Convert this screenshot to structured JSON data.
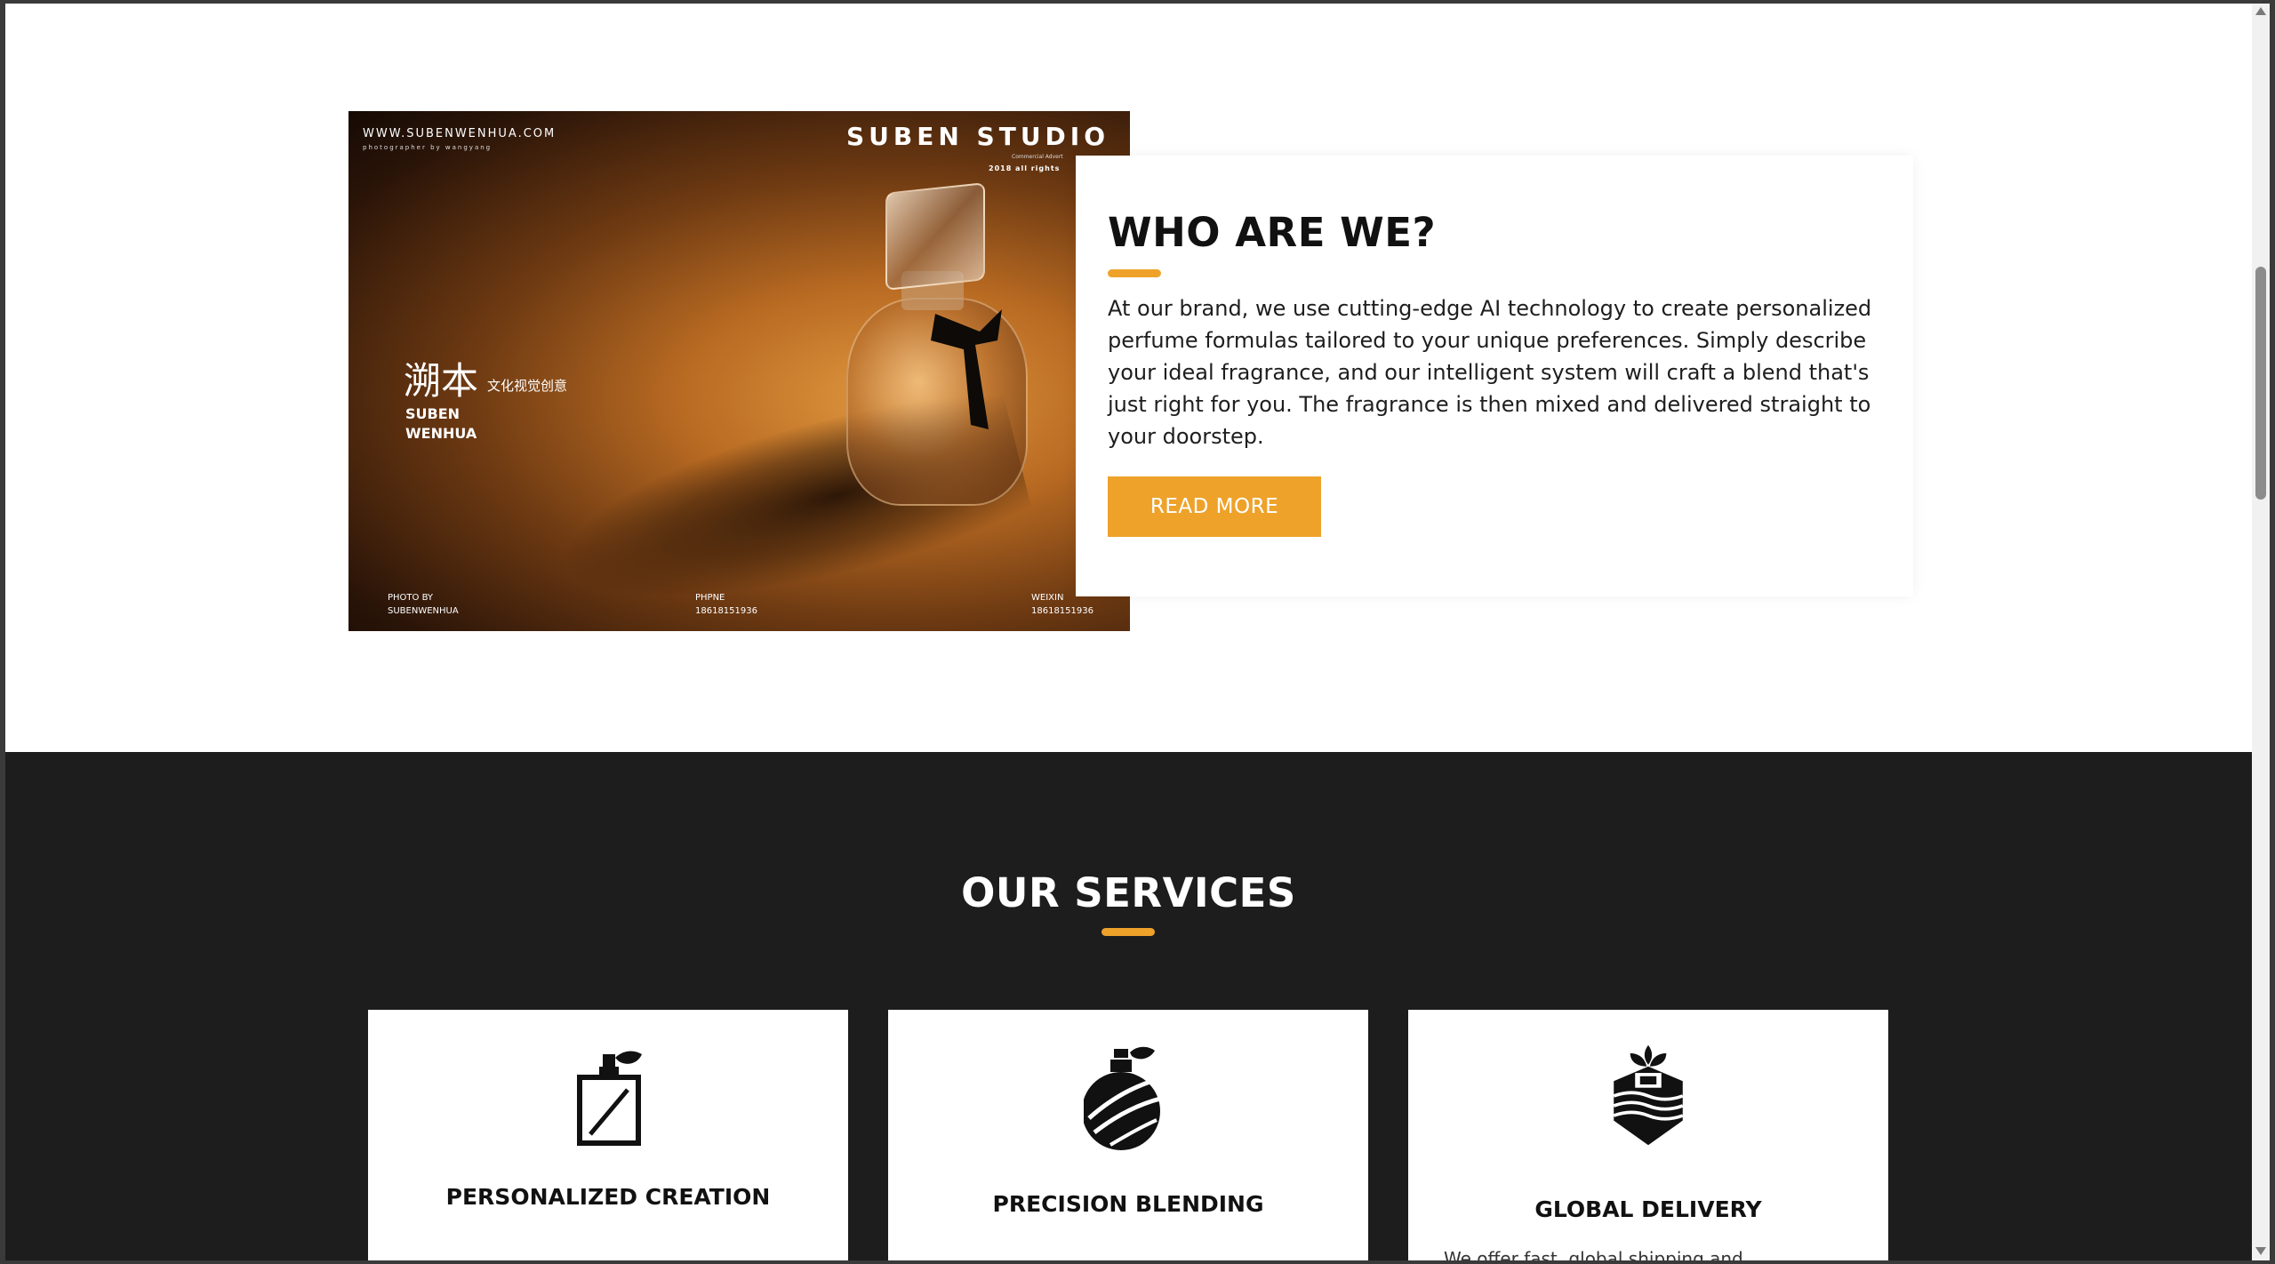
{
  "photo": {
    "url_text": "WWW.SUBENWENHUA.COM",
    "photographer_text": "photographer by wangyang",
    "studio_text": "SUBEN STUDIO",
    "commercial_text": "Commercial Advert",
    "rights_text": "2018 all rights",
    "cn_name": "溯本",
    "cn_tagline": "文化视觉创意",
    "brand_line1": "SUBEN",
    "brand_line2": "WENHUA",
    "footer": [
      {
        "label": "PHOTO BY",
        "value": "SUBENWENHUA"
      },
      {
        "label": "PHPNE",
        "value": "18618151936"
      },
      {
        "label": "WEIXIN",
        "value": "18618151936"
      }
    ]
  },
  "about": {
    "title": "WHO ARE WE?",
    "text": "At our brand, we use cutting-edge AI technology to create personalized perfume formulas tailored to your unique preferences. Simply describe your ideal fragrance, and our intelligent system will craft a blend that's just right for you. The fragrance is then mixed and delivered straight to your doorstep.",
    "button_label": "READ MORE"
  },
  "services": {
    "title": "OUR SERVICES",
    "items": [
      {
        "title": "PERSONALIZED CREATION",
        "icon": "perfume-spray-icon"
      },
      {
        "title": "PRECISION BLENDING",
        "icon": "perfume-bottle-icon"
      },
      {
        "title": "GLOBAL DELIVERY",
        "icon": "gift-box-icon",
        "description": "We offer fast, global shipping and..."
      }
    ]
  },
  "colors": {
    "accent": "#eea22a",
    "dark_section": "#1d1d1d",
    "heading": "#111111"
  }
}
